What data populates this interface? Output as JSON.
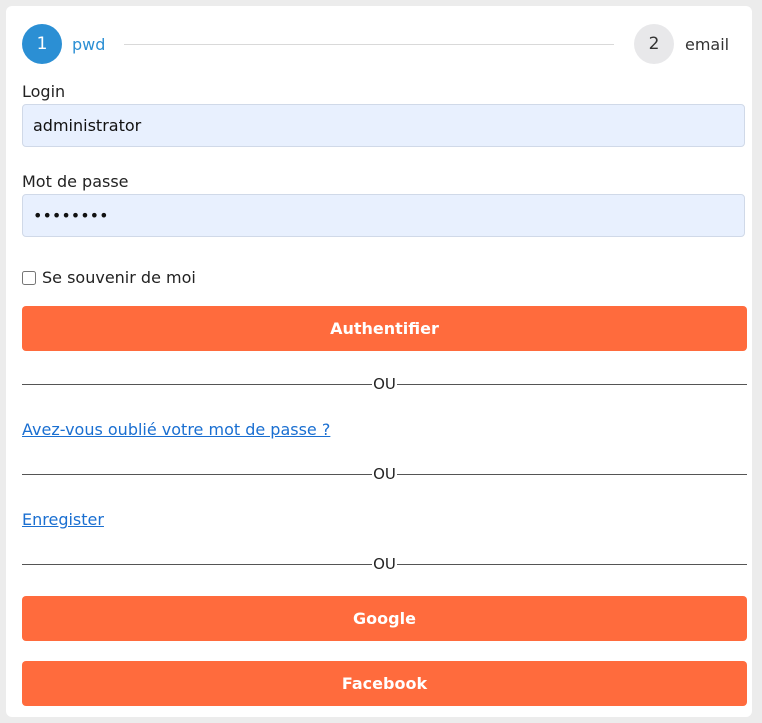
{
  "stepper": {
    "steps": [
      {
        "number": "1",
        "label": "pwd"
      },
      {
        "number": "2",
        "label": "email"
      }
    ],
    "active_color": "#2b8fd4"
  },
  "form": {
    "login_label": "Login",
    "login_value": "administrator",
    "password_label": "Mot de passe",
    "password_value": "password",
    "remember_label": "Se souvenir de moi",
    "submit_label": "Authentifier"
  },
  "divider_text": "OU",
  "links": {
    "forgot_password": "Avez-vous oublié votre mot de passe ?",
    "register": "Enregister"
  },
  "social": {
    "google_label": "Google",
    "facebook_label": "Facebook"
  },
  "colors": {
    "button": "#ff6b3d",
    "link": "#1a6fd1",
    "input_bg": "#e8f0fe"
  }
}
